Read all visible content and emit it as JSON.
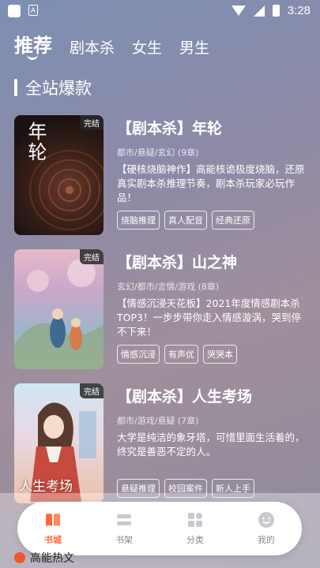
{
  "status_bar": {
    "time": "3:28",
    "notif_letter": "A"
  },
  "tabs": [
    {
      "label": "推荐",
      "active": true
    },
    {
      "label": "剧本杀"
    },
    {
      "label": "女生"
    },
    {
      "label": "男生"
    }
  ],
  "section": {
    "title": "全站爆款"
  },
  "books": [
    {
      "badge": "完结",
      "cover_text": "年轮",
      "title": "【剧本杀】年轮",
      "meta": "都市/悬疑/玄幻 (9章)",
      "desc": "【硬核烧脑神作】高能核诡极度烧脑，还原真实剧本杀推理节奏，剧本杀玩家必玩作品！",
      "tags": [
        "烧脑推理",
        "真人配音",
        "经典还原"
      ]
    },
    {
      "badge": "完结",
      "cover_text": "",
      "title": "【剧本杀】山之神",
      "meta": "玄幻/都市/言情/游戏 (8章)",
      "desc": "【情感沉浸天花板】2021年度情感剧本杀TOP3！一步步带你走入情感漩涡，哭到停不下来！",
      "tags": [
        "情感沉浸",
        "有声优",
        "哭哭本"
      ]
    },
    {
      "badge": "完结",
      "cover_text": "人生考场",
      "title": "【剧本杀】人生考场",
      "meta": "都市/游戏/悬疑 (7章)",
      "desc": "大学是纯洁的象牙塔，可惜里面生活着的，终究是善恶不定的人。",
      "tags": [
        "悬疑推理",
        "校园案件",
        "新人上手"
      ]
    }
  ],
  "nav": [
    {
      "label": "书城",
      "icon": "book-open-icon",
      "active": true
    },
    {
      "label": "书架",
      "icon": "bookshelf-icon"
    },
    {
      "label": "分类",
      "icon": "category-grid-icon"
    },
    {
      "label": "我的",
      "icon": "smiley-profile-icon"
    }
  ],
  "footer": {
    "logo_text": "高能热文"
  },
  "colors": {
    "accent": "#ff6a3a",
    "bg_top": "#7d8fb3",
    "bg_mid": "#a08f9c"
  }
}
